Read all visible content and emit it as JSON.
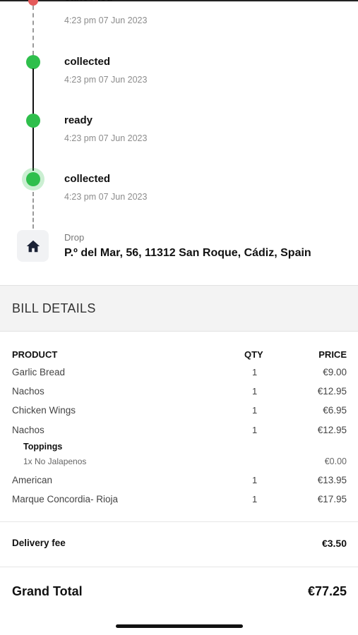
{
  "timeline": {
    "partial_status": "cancelled",
    "events": [
      {
        "status": "",
        "time": "4:23 pm 07 Jun 2023"
      },
      {
        "status": "collected",
        "time": "4:23 pm 07 Jun 2023"
      },
      {
        "status": "ready",
        "time": "4:23 pm 07 Jun 2023"
      },
      {
        "status": "collected",
        "time": "4:23 pm 07 Jun 2023"
      }
    ],
    "drop": {
      "label": "Drop",
      "address": "P.º del Mar, 56, 11312 San Roque, Cádiz, Spain",
      "icon": "home-icon"
    },
    "colors": {
      "done": "#2fbf4c",
      "cancelled": "#e45b5b"
    }
  },
  "bill": {
    "title": "BILL DETAILS",
    "headers": {
      "product": "PRODUCT",
      "qty": "QTY",
      "price": "PRICE"
    },
    "items": [
      {
        "name": "Garlic Bread",
        "qty": "1",
        "price": "€9.00"
      },
      {
        "name": "Nachos",
        "qty": "1",
        "price": "€12.95"
      },
      {
        "name": "Chicken Wings",
        "qty": "1",
        "price": "€6.95"
      },
      {
        "name": "Nachos",
        "qty": "1",
        "price": "€12.95",
        "toppings_label": "Toppings",
        "toppings": [
          {
            "name": "1x No Jalapenos",
            "price": "€0.00"
          }
        ]
      },
      {
        "name": "American",
        "qty": "1",
        "price": "€13.95"
      },
      {
        "name": "Marque Concordia- Rioja",
        "qty": "1",
        "price": "€17.95"
      }
    ],
    "delivery_fee": {
      "label": "Delivery fee",
      "value": "€3.50"
    },
    "grand_total": {
      "label": "Grand Total",
      "value": "€77.25"
    }
  }
}
